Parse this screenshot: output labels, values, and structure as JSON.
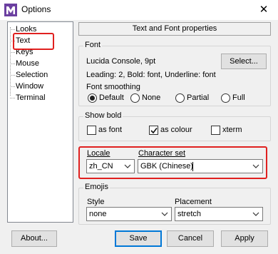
{
  "window": {
    "title": "Options",
    "close_glyph": "✕"
  },
  "tree": {
    "items": [
      {
        "label": "Looks",
        "selected": false
      },
      {
        "label": "Text",
        "selected": true
      },
      {
        "label": "Keys",
        "selected": false
      },
      {
        "label": "Mouse",
        "selected": false
      },
      {
        "label": "Selection",
        "selected": false
      },
      {
        "label": "Window",
        "selected": false
      },
      {
        "label": "Terminal",
        "selected": false
      }
    ]
  },
  "panel": {
    "header": "Text and Font properties"
  },
  "font": {
    "legend": "Font",
    "current": "Lucida Console, 9pt",
    "select_button": "Select...",
    "details": "Leading: 2, Bold: font, Underline: font",
    "smoothing_label": "Font smoothing",
    "smoothing_options": [
      {
        "label": "Default",
        "checked": true
      },
      {
        "label": "None",
        "checked": false
      },
      {
        "label": "Partial",
        "checked": false
      },
      {
        "label": "Full",
        "checked": false
      }
    ]
  },
  "show_bold": {
    "legend": "Show bold",
    "options": [
      {
        "label": "as font",
        "checked": false
      },
      {
        "label": "as colour",
        "checked": true
      },
      {
        "label": "xterm",
        "checked": false
      }
    ]
  },
  "locale": {
    "label": "Locale",
    "value": "zh_CN"
  },
  "charset": {
    "label": "Character set",
    "value": "GBK (Chinese)"
  },
  "emojis": {
    "legend": "Emojis",
    "style_label": "Style",
    "style_value": "none",
    "placement_label": "Placement",
    "placement_value": "stretch"
  },
  "buttons": {
    "about": "About...",
    "save": "Save",
    "cancel": "Cancel",
    "apply": "Apply"
  },
  "colors": {
    "highlight": "#e0201f",
    "focus": "#0078d7"
  },
  "icons": {
    "app": "mintty-m-icon",
    "dropdown": "chevron-down-icon",
    "check": "checkmark-icon"
  }
}
